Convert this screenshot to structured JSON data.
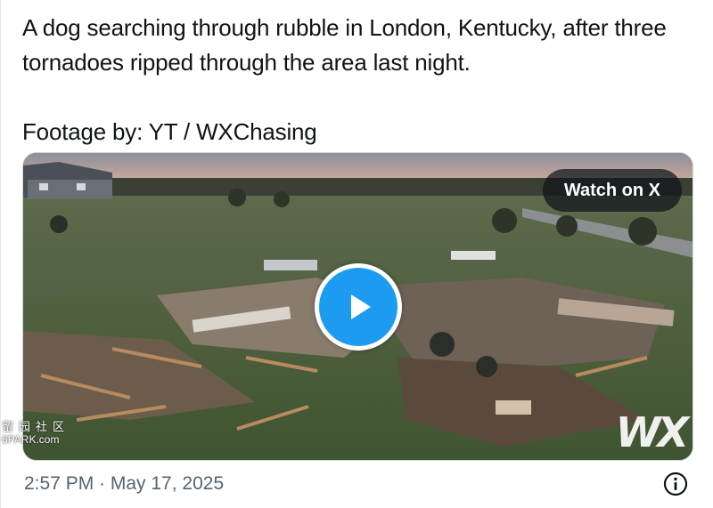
{
  "tweet": {
    "line1": "A dog searching through rubble in London, Kentucky, after three tornadoes ripped through the area last night.",
    "line2": "Footage by: YT / WXChasing"
  },
  "media": {
    "watch_label": "Watch on X",
    "watermark_cn": "留园社区",
    "watermark_site": "6PARK.com",
    "channel_logo": "WX"
  },
  "footer": {
    "timestamp": "2:57 PM · May 17, 2025"
  },
  "colors": {
    "accent": "#1d9bf0",
    "muted": "#536471"
  },
  "icons": {
    "play": "play-icon",
    "info": "info-icon"
  }
}
